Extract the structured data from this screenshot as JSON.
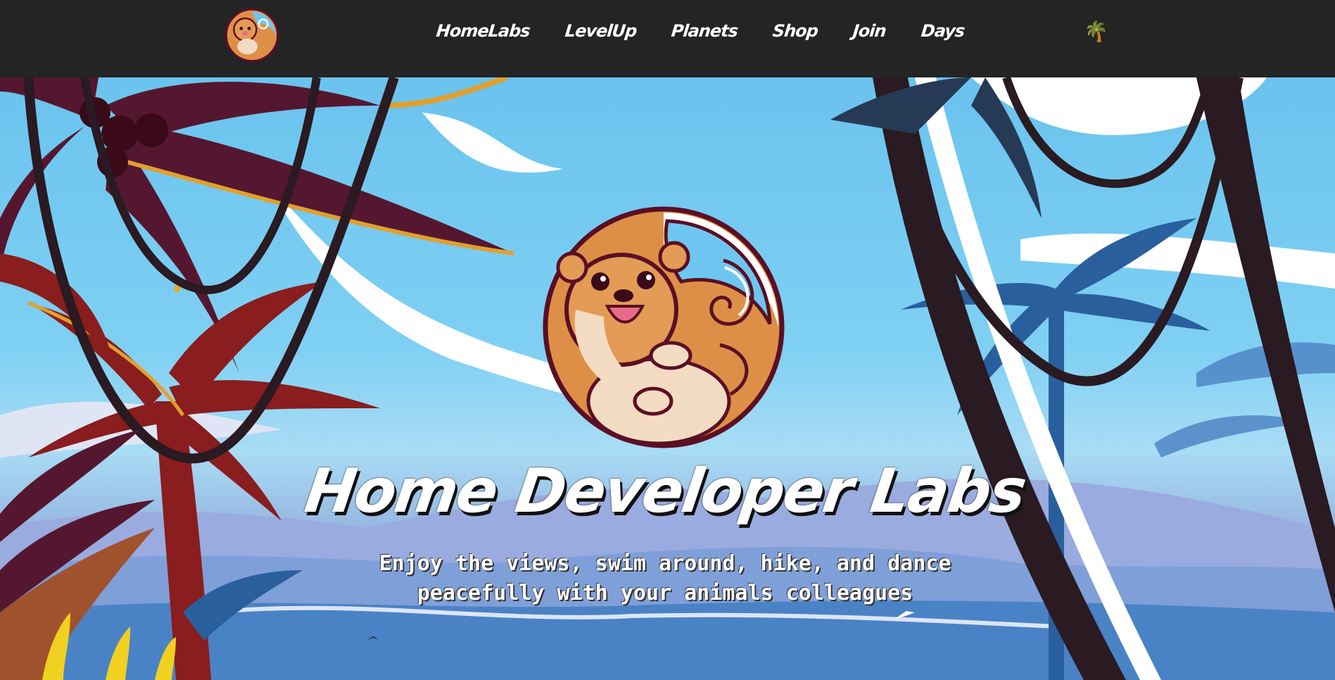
{
  "nav": {
    "logo_icon": "otter-logo-icon",
    "links": [
      "HomeLabs",
      "LevelUp",
      "Planets",
      "Shop",
      "Join",
      "Days"
    ],
    "theme_toggle": "🌴"
  },
  "hero": {
    "title": "Home Developer Labs",
    "subtitle": "Enjoy the views, swim around, hike, and dance peacefully with your animals colleagues",
    "illustration": "tropical-beach-scene",
    "mascot_icon": "otter-wave-icon"
  },
  "colors": {
    "navbar_bg": "#242424",
    "sky": "#6ac3ee",
    "palm_dark_red": "#55172f",
    "palm_red": "#8a1d1d",
    "palm_blue": "#2a5f9e",
    "trunk_dark": "#2a1a22",
    "otter_orange": "#de8f47"
  }
}
